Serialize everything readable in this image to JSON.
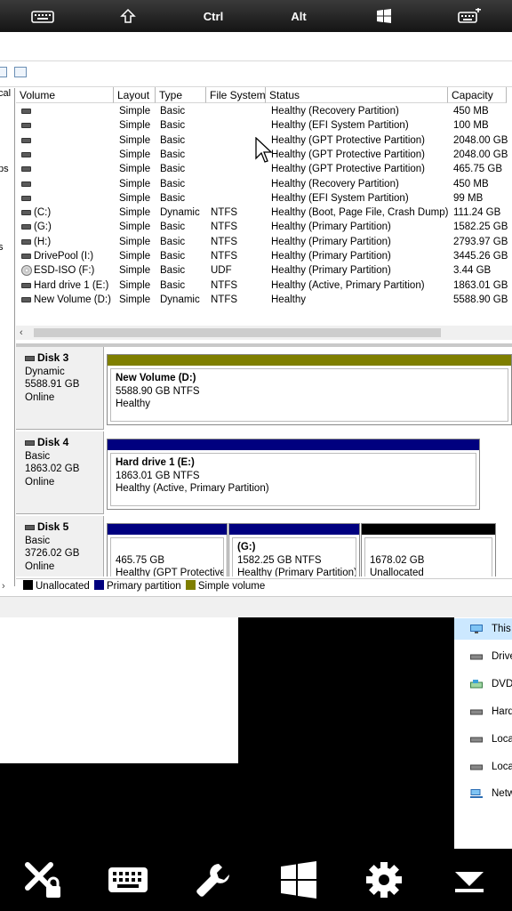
{
  "topbar": {
    "keys": [
      {
        "icon": "keyboard-icon"
      },
      {
        "icon": "shift-icon"
      },
      {
        "label": "Ctrl"
      },
      {
        "label": "Alt"
      },
      {
        "icon": "windows-icon"
      },
      {
        "icon": "keyboard-plus-icon"
      }
    ]
  },
  "left_pane": {
    "fragments": [
      "cal",
      "ps",
      "s"
    ]
  },
  "volume_list": {
    "columns": [
      "Volume",
      "Layout",
      "Type",
      "File System",
      "Status",
      "Capacity"
    ],
    "rows": [
      {
        "volume": "",
        "layout": "Simple",
        "type": "Basic",
        "fs": "",
        "status": "Healthy (Recovery Partition)",
        "capacity": "450 MB",
        "icon": "drive"
      },
      {
        "volume": "",
        "layout": "Simple",
        "type": "Basic",
        "fs": "",
        "status": "Healthy (EFI System Partition)",
        "capacity": "100 MB",
        "icon": "drive"
      },
      {
        "volume": "",
        "layout": "Simple",
        "type": "Basic",
        "fs": "",
        "status": "Healthy (GPT Protective Partition)",
        "capacity": "2048.00 GB",
        "icon": "drive"
      },
      {
        "volume": "",
        "layout": "Simple",
        "type": "Basic",
        "fs": "",
        "status": "Healthy (GPT Protective Partition)",
        "capacity": "2048.00 GB",
        "icon": "drive"
      },
      {
        "volume": "",
        "layout": "Simple",
        "type": "Basic",
        "fs": "",
        "status": "Healthy (GPT Protective Partition)",
        "capacity": "465.75 GB",
        "icon": "drive"
      },
      {
        "volume": "",
        "layout": "Simple",
        "type": "Basic",
        "fs": "",
        "status": "Healthy (Recovery Partition)",
        "capacity": "450 MB",
        "icon": "drive"
      },
      {
        "volume": "",
        "layout": "Simple",
        "type": "Basic",
        "fs": "",
        "status": "Healthy (EFI System Partition)",
        "capacity": "99 MB",
        "icon": "drive"
      },
      {
        "volume": "(C:)",
        "layout": "Simple",
        "type": "Dynamic",
        "fs": "NTFS",
        "status": "Healthy (Boot, Page File, Crash Dump)",
        "capacity": "111.24 GB",
        "icon": "drive"
      },
      {
        "volume": "(G:)",
        "layout": "Simple",
        "type": "Basic",
        "fs": "NTFS",
        "status": "Healthy (Primary Partition)",
        "capacity": "1582.25 GB",
        "icon": "drive"
      },
      {
        "volume": "(H:)",
        "layout": "Simple",
        "type": "Basic",
        "fs": "NTFS",
        "status": "Healthy (Primary Partition)",
        "capacity": "2793.97 GB",
        "icon": "drive"
      },
      {
        "volume": "DrivePool (I:)",
        "layout": "Simple",
        "type": "Basic",
        "fs": "NTFS",
        "status": "Healthy (Primary Partition)",
        "capacity": "3445.26 GB",
        "icon": "drive"
      },
      {
        "volume": "ESD-ISO (F:)",
        "layout": "Simple",
        "type": "Basic",
        "fs": "UDF",
        "status": "Healthy (Primary Partition)",
        "capacity": "3.44 GB",
        "icon": "disc"
      },
      {
        "volume": "Hard drive 1 (E:)",
        "layout": "Simple",
        "type": "Basic",
        "fs": "NTFS",
        "status": "Healthy (Active, Primary Partition)",
        "capacity": "1863.01 GB",
        "icon": "drive"
      },
      {
        "volume": "New Volume (D:)",
        "layout": "Simple",
        "type": "Dynamic",
        "fs": "NTFS",
        "status": "Healthy",
        "capacity": "5588.90 GB",
        "icon": "drive"
      }
    ],
    "scroll_left_arrow": "‹"
  },
  "disks": [
    {
      "name": "Disk 3",
      "kind": "Dynamic",
      "size": "5588.91 GB",
      "state": "Online",
      "partitions": [
        {
          "title": "New Volume  (D:)",
          "line2": "5588.90 GB NTFS",
          "line3": "Healthy",
          "bar_color": "#7f7f00"
        }
      ]
    },
    {
      "name": "Disk 4",
      "kind": "Basic",
      "size": "1863.02 GB",
      "state": "Online",
      "partitions": [
        {
          "title": "Hard drive 1  (E:)",
          "line2": "1863.01 GB NTFS",
          "line3": "Healthy (Active, Primary Partition)",
          "bar_color": "#00007f"
        }
      ]
    },
    {
      "name": "Disk 5",
      "kind": "Basic",
      "size": "3726.02 GB",
      "state": "Online",
      "partitions": [
        {
          "title": "",
          "line2": "465.75 GB",
          "line3": "Healthy (GPT Protective",
          "bar_color": "#00007f"
        },
        {
          "title": "(G:)",
          "line2": "1582.25 GB NTFS",
          "line3": "Healthy (Primary Partition)",
          "bar_color": "#00007f"
        },
        {
          "title": "",
          "line2": "1678.02 GB",
          "line3": "Unallocated",
          "bar_color": "#000000"
        }
      ]
    }
  ],
  "legend": {
    "arrow": "›",
    "items": [
      {
        "label": "Unallocated",
        "color": "#000000"
      },
      {
        "label": "Primary partition",
        "color": "#00007f"
      },
      {
        "label": "Simple volume",
        "color": "#7f7f00"
      }
    ]
  },
  "explorer": {
    "items": [
      {
        "label": "This",
        "icon": "monitor-icon",
        "selected": true
      },
      {
        "label": "Drive",
        "icon": "drive-icon"
      },
      {
        "label": "DVD",
        "icon": "dvd-drive-icon"
      },
      {
        "label": "Hard",
        "icon": "drive-icon"
      },
      {
        "label": "Loca",
        "icon": "drive-icon"
      },
      {
        "label": "Loca",
        "icon": "drive-icon"
      },
      {
        "label": "Netw",
        "icon": "network-icon"
      }
    ]
  },
  "bottombar": {
    "buttons": [
      "disconnect-lock-icon",
      "keyboard-icon",
      "wrench-icon",
      "windows-start-icon",
      "settings-gear-icon",
      "collapse-down-icon"
    ]
  }
}
